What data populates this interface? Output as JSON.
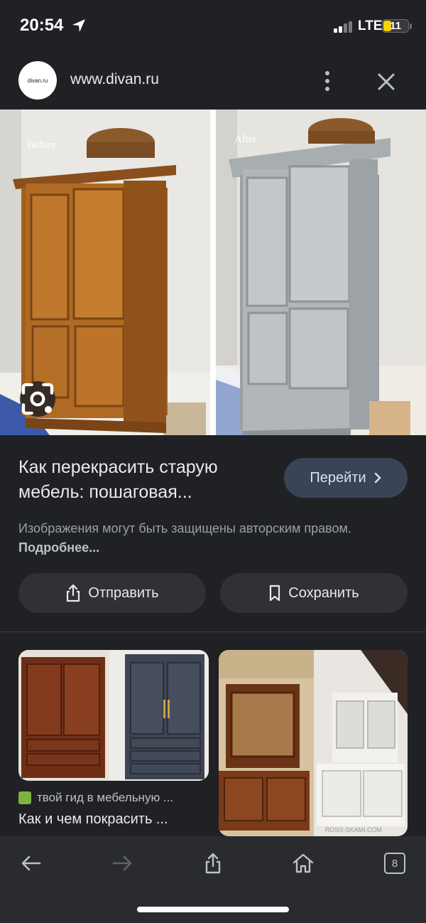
{
  "status_bar": {
    "time": "20:54",
    "network": "LTE",
    "battery": "11"
  },
  "header": {
    "logo_text": "divan.ru",
    "url": "www.divan.ru"
  },
  "hero": {
    "before_label": "Before",
    "after_label": "After"
  },
  "result": {
    "title": "Как перекрасить старую мебель: пошаговая...",
    "go_button": "Перейти",
    "copyright_text": "Изображения могут быть защищены авторским правом.",
    "copyright_link": "Подробнее..."
  },
  "actions": {
    "share": "Отправить",
    "save": "Сохранить"
  },
  "related": {
    "source": "твой гид в мебельную ...",
    "title": "Как и чем покрасить ...",
    "watermark": "ROSS-SKAMI.COM"
  },
  "bottom_bar": {
    "tabs_count": "8"
  },
  "colors": {
    "background": "#202124",
    "button": "#303134",
    "accent_button": "#394457"
  }
}
